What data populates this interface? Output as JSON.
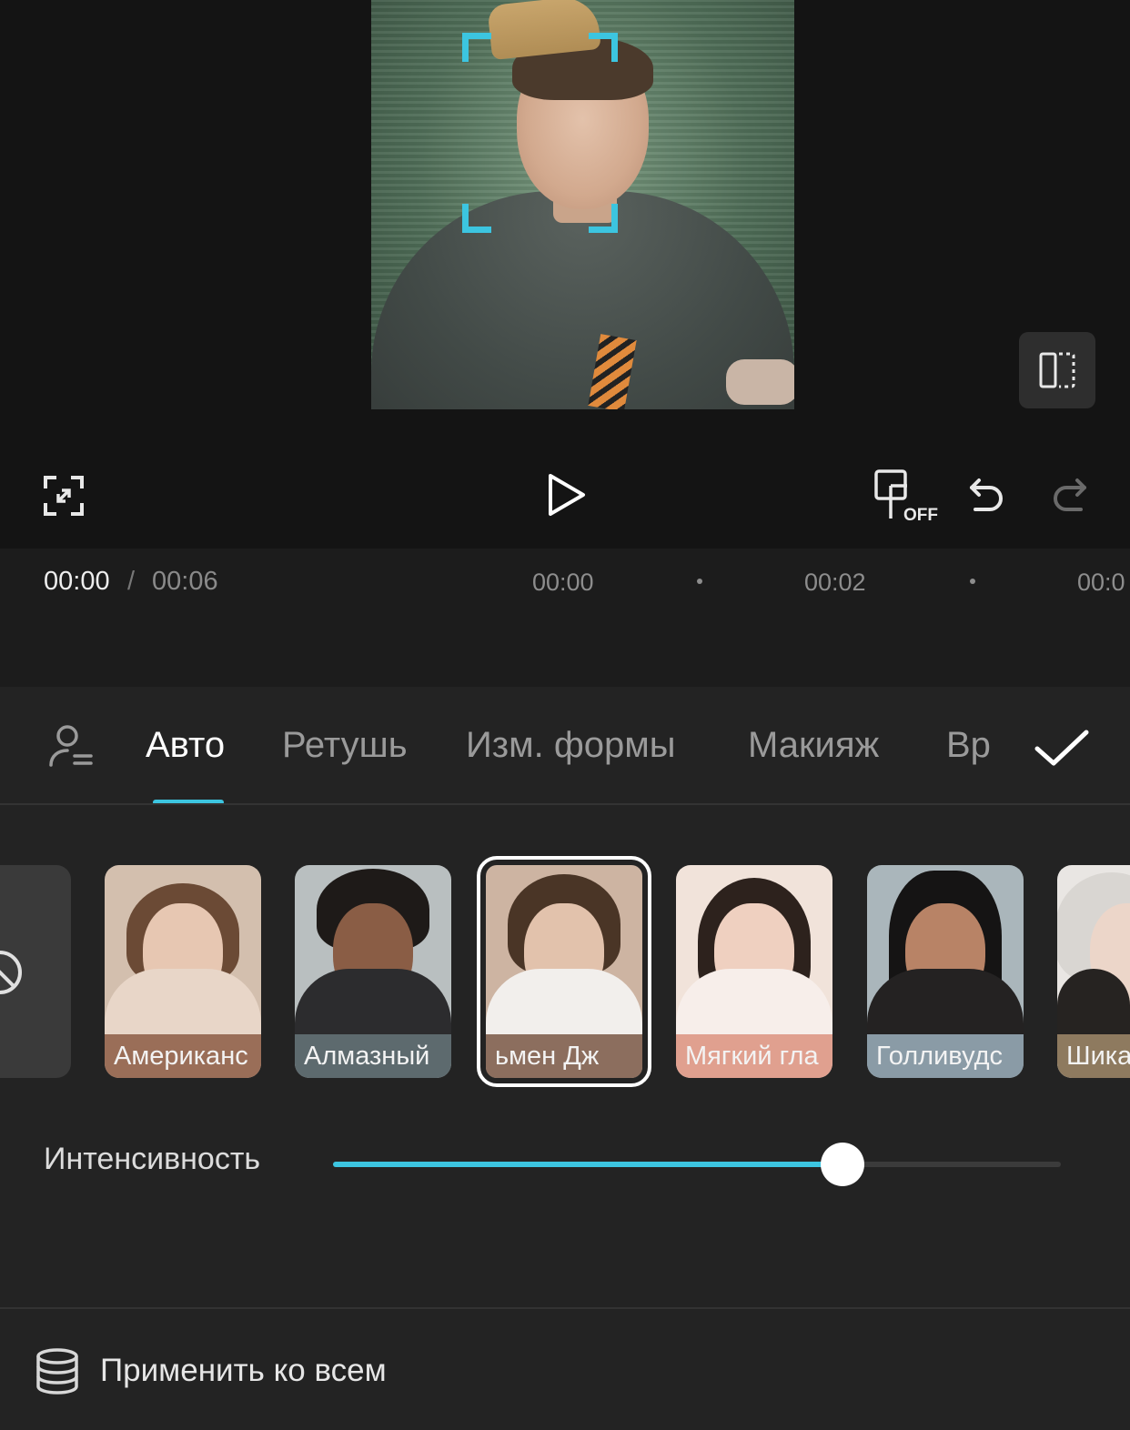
{
  "player": {
    "current_time": "00:00",
    "separator": "/",
    "total_time": "00:06",
    "keyframe_badge": "OFF"
  },
  "ruler": {
    "labels": [
      "00:00",
      "00:02",
      "00:0"
    ]
  },
  "tabs": [
    {
      "label": "Авто",
      "active": true
    },
    {
      "label": "Ретушь",
      "active": false
    },
    {
      "label": "Изм. формы",
      "active": false
    },
    {
      "label": "Макияж",
      "active": false
    },
    {
      "label": "Вр",
      "active": false
    }
  ],
  "presets": [
    {
      "label": "Американс",
      "color": "#9a6e58",
      "selected": false
    },
    {
      "label": "Алмазный",
      "color": "#5d6a6e",
      "selected": false
    },
    {
      "label": "ьмен    Дж",
      "color": "#8c6e5e",
      "selected": true
    },
    {
      "label": "Мягкий гла",
      "color": "#e0a08f",
      "selected": false
    },
    {
      "label": "Голливудс",
      "color": "#8a9ba6",
      "selected": false
    },
    {
      "label": "Шика",
      "color": "#8e7a5f",
      "selected": false
    }
  ],
  "intensity": {
    "label": "Интенсивность",
    "value": 0.7,
    "accent": "#3cc5e0"
  },
  "apply_all": {
    "label": "Применить ко всем"
  },
  "icons": {
    "fullscreen": "fullscreen-icon",
    "play": "play-icon",
    "keyframe": "keyframe-off-icon",
    "undo": "undo-icon",
    "redo": "redo-icon",
    "compare": "compare-icon",
    "face": "face-list-icon",
    "confirm": "check-icon",
    "none": "none-icon",
    "apply": "database-stack-icon"
  }
}
